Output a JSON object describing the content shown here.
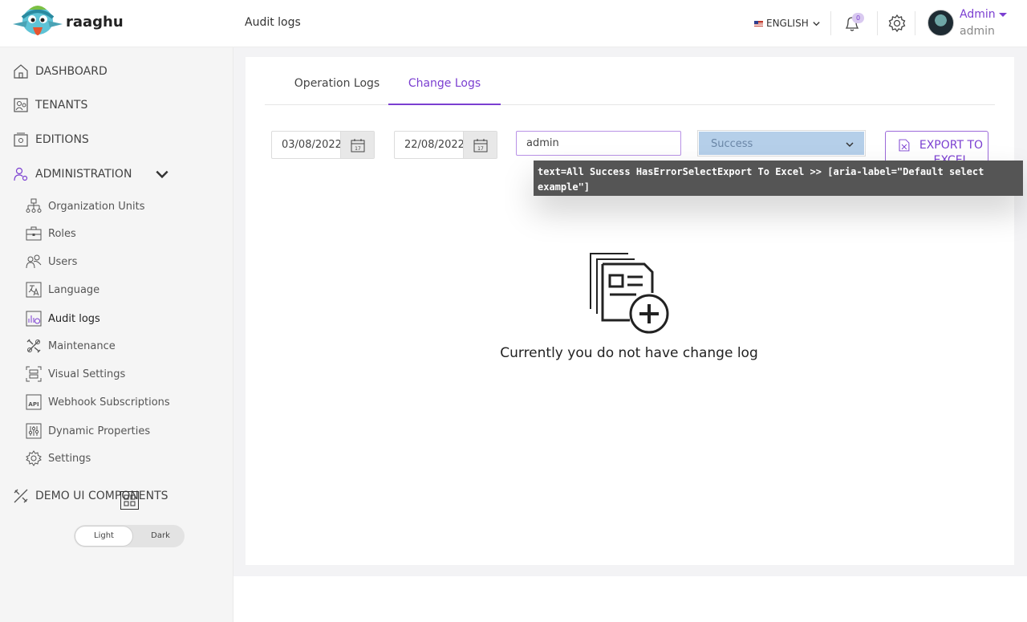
{
  "brand": {
    "name": "raaghu"
  },
  "header": {
    "page_title": "Audit logs",
    "language": "ENGLISH",
    "notification_count": "0",
    "user_name": "Admin",
    "user_sub": "admin"
  },
  "sidebar": {
    "items": [
      {
        "label": "DASHBOARD",
        "icon": "home-icon"
      },
      {
        "label": "TENANTS",
        "icon": "tenants-icon"
      },
      {
        "label": "EDITIONS",
        "icon": "editions-icon"
      },
      {
        "label": "ADMINISTRATION",
        "icon": "administration-icon"
      },
      {
        "label": "DEMO UI COMPONENTS",
        "icon": "components-icon"
      }
    ],
    "sub_items": [
      {
        "label": "Organization Units",
        "icon": "org-tree-icon"
      },
      {
        "label": "Roles",
        "icon": "briefcase-icon"
      },
      {
        "label": "Users",
        "icon": "users-icon"
      },
      {
        "label": "Language",
        "icon": "language-icon"
      },
      {
        "label": "Audit logs",
        "icon": "audit-chart-icon"
      },
      {
        "label": "Maintenance",
        "icon": "tools-icon"
      },
      {
        "label": "Visual Settings",
        "icon": "visual-settings-icon"
      },
      {
        "label": "Webhook Subscriptions",
        "icon": "api-icon"
      },
      {
        "label": "Dynamic Properties",
        "icon": "sliders-icon"
      },
      {
        "label": "Settings",
        "icon": "gear-icon"
      }
    ],
    "theme": {
      "light": "Light",
      "dark": "Dark"
    }
  },
  "tabs": [
    {
      "label": "Operation Logs"
    },
    {
      "label": "Change Logs"
    }
  ],
  "filters": {
    "start_date": "03/08/2022",
    "end_date": "22/08/2022",
    "user_value": "admin",
    "status_selected": "Success",
    "export_label": "EXPORT TO EXCEL"
  },
  "tooltip": "text=All Success HasErrorSelectExport To Excel >> [aria-label=\"Default select example\"]",
  "empty_state": {
    "message": "Currently you do not have change log"
  },
  "colors": {
    "accent": "#7b3fd1",
    "select_bg": "#b5cfe9"
  }
}
